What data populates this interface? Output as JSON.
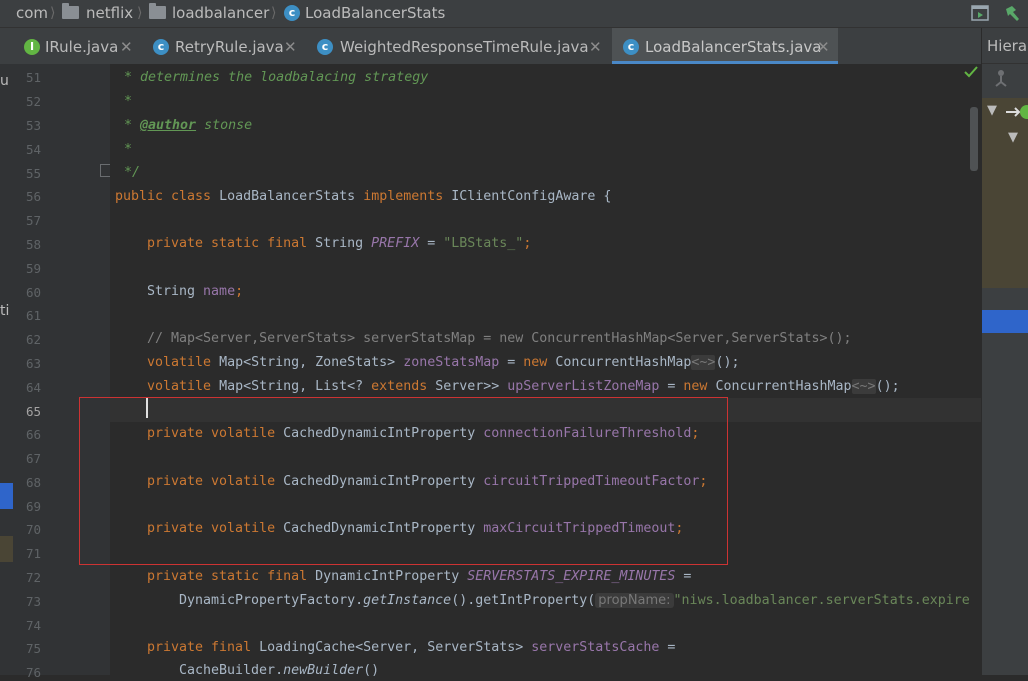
{
  "breadcrumb": [
    "com",
    "netflix",
    "loadbalancer",
    "LoadBalancerStats"
  ],
  "tabs": [
    {
      "label": "IRule.java"
    },
    {
      "label": "RetryRule.java"
    },
    {
      "label": "WeightedResponseTimeRule.java"
    },
    {
      "label": "LoadBalancerStats.java"
    }
  ],
  "right_panel": {
    "title": "Hierar"
  },
  "left_gutter_fragments": {
    "a": "u",
    "b": "ti"
  },
  "code": {
    "line_numbers": [
      "51",
      "52",
      "53",
      "54",
      "55",
      "56",
      "57",
      "58",
      "59",
      "60",
      "61",
      "62",
      "63",
      "64",
      "65",
      "66",
      "67",
      "68",
      "69",
      "70",
      "71",
      "72",
      "73",
      "74",
      "75",
      "76"
    ],
    "l51": "* determines the loadbalacing strategy",
    "l52": "*",
    "l53": {
      "star": "* ",
      "tag": "@author",
      "rest": " stonse"
    },
    "l54": "*",
    "l55": "*/",
    "l56": {
      "kw": "public class ",
      "name": "LoadBalancerStats ",
      "kw2": "implements ",
      "rest": "IClientConfigAware {"
    },
    "l58": {
      "kw": "private static final ",
      "type": "String ",
      "field": "PREFIX",
      "eq": " = ",
      "str": "\"LBStats_\"",
      "end": ";"
    },
    "l60": {
      "type": "String ",
      "field": "name",
      "end": ";"
    },
    "l62": "// Map<Server,ServerStats> serverStatsMap = new ConcurrentHashMap<Server,ServerStats>();",
    "l63": {
      "kw": "volatile ",
      "type": "Map<String, ZoneStats> ",
      "field": "zoneStatsMap",
      "eq": " = ",
      "kw2": "new ",
      "ctor": "ConcurrentHashMap",
      "hint": "<~>",
      "end": "();"
    },
    "l64": {
      "kw": "volatile ",
      "type": "Map<String, List<? ",
      "kw_ext": "extends ",
      "type2": "Server>> ",
      "field": "upServerListZoneMap",
      "eq": " = ",
      "kw2": "new ",
      "ctor": "ConcurrentHashMap",
      "hint": "<~>",
      "end": "();"
    },
    "l66": {
      "kw": "private volatile ",
      "type": "CachedDynamicIntProperty ",
      "field": "connectionFailureThreshold",
      "end": ";"
    },
    "l68": {
      "kw": "private volatile ",
      "type": "CachedDynamicIntProperty ",
      "field": "circuitTrippedTimeoutFactor",
      "end": ";"
    },
    "l70": {
      "kw": "private volatile ",
      "type": "CachedDynamicIntProperty ",
      "field": "maxCircuitTrippedTimeout",
      "end": ";"
    },
    "l72": {
      "kw": "private static final ",
      "type": "DynamicIntProperty ",
      "field": "SERVERSTATS_EXPIRE_MINUTES",
      "eq": " ="
    },
    "l73": {
      "cls": "DynamicPropertyFactory.",
      "method": "getInstance",
      "call": "().getIntProperty(",
      "param": "propName:",
      "str": "\"niws.loadbalancer.serverStats.expire"
    },
    "l75": {
      "kw": "private final ",
      "type": "LoadingCache<Server, ServerStats> ",
      "field": "serverStatsCache",
      "eq": " ="
    },
    "l76": {
      "cls": "CacheBuilder.",
      "method": "newBuilder",
      "end": "()"
    }
  }
}
